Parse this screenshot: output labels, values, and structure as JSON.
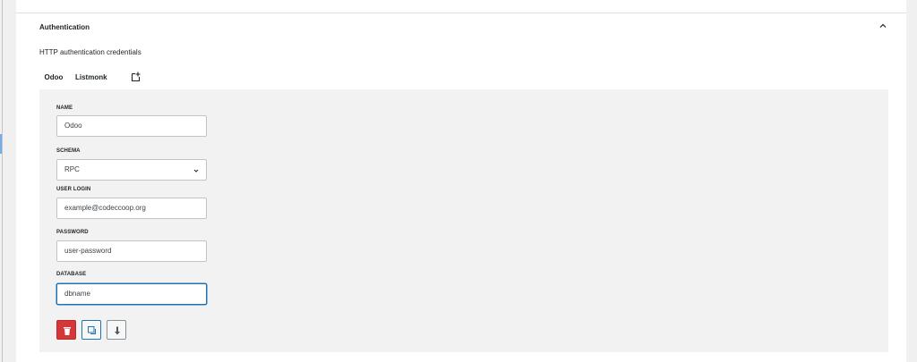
{
  "section": {
    "title": "Authentication",
    "description": "HTTP authentication credentials",
    "collapse_icon": "chevron-up-icon"
  },
  "tabs": [
    {
      "label": "Odoo",
      "active": true
    },
    {
      "label": "Listmonk",
      "active": false
    }
  ],
  "add_tab_icon": "add-tab-icon",
  "form": {
    "name": {
      "label": "NAME",
      "value": "Odoo"
    },
    "schema": {
      "label": "SCHEMA",
      "value": "RPC"
    },
    "user_login": {
      "label": "USER LOGIN",
      "value": "example@codeccoop.org"
    },
    "password": {
      "label": "PASSWORD",
      "value": "user-password"
    },
    "database": {
      "label": "DATABASE",
      "value": "dbname"
    }
  },
  "actions": {
    "delete_icon": "trash-icon",
    "copy_icon": "copy-icon",
    "download_icon": "arrow-down-icon"
  },
  "colors": {
    "accent": "#2271b1",
    "danger": "#d63638",
    "form_background": "#f2f2f2"
  }
}
